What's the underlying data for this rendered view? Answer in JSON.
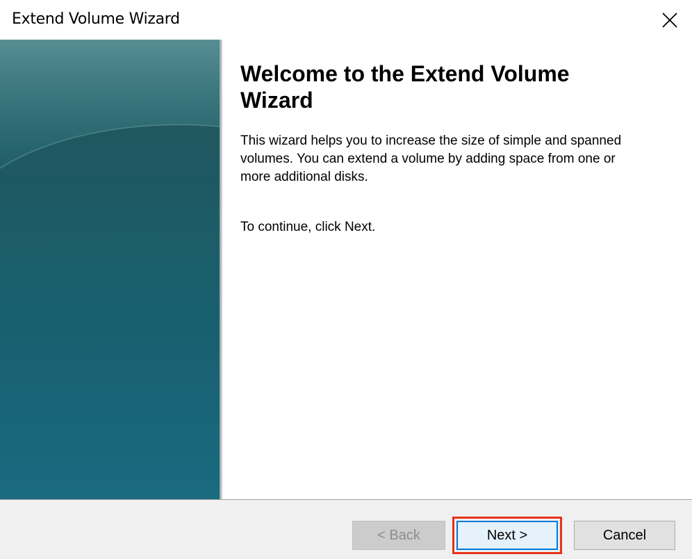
{
  "window": {
    "title": "Extend Volume Wizard",
    "close_icon": "close-icon"
  },
  "main": {
    "heading": "Welcome to the Extend Volume Wizard",
    "description": "This wizard helps you to increase the size of simple and spanned volumes. You can extend a volume by adding space from one or more additional disks.",
    "continue_text": "To continue, click Next."
  },
  "buttons": {
    "back": "< Back",
    "next": "Next >",
    "cancel": "Cancel"
  },
  "colors": {
    "banner_top": "#3e7a80",
    "banner_bottom": "#1a6a80",
    "highlight": "#e8321c",
    "focus": "#0078d7"
  }
}
